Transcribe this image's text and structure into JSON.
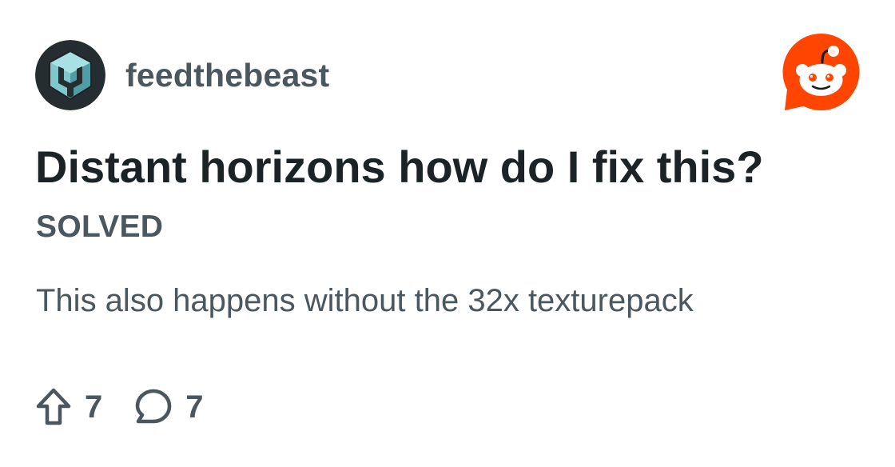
{
  "subreddit": {
    "name": "feedthebeast",
    "avatar_icon": "ftb-logo-icon"
  },
  "brand": {
    "logo_icon": "reddit-logo-icon",
    "accent": "#ff4500"
  },
  "post": {
    "title": "Distant horizons how do I fix this?",
    "flair": "SOLVED",
    "body": "This also happens without the 32x texturepack"
  },
  "stats": {
    "upvotes": "7",
    "upvote_icon": "upvote-arrow-icon",
    "comments": "7",
    "comment_icon": "comment-bubble-icon"
  },
  "colors": {
    "title": "#1c2327",
    "secondary_text": "#4a575f",
    "avatar_bg": "#262d30",
    "avatar_accent": "#7fc7cc"
  }
}
